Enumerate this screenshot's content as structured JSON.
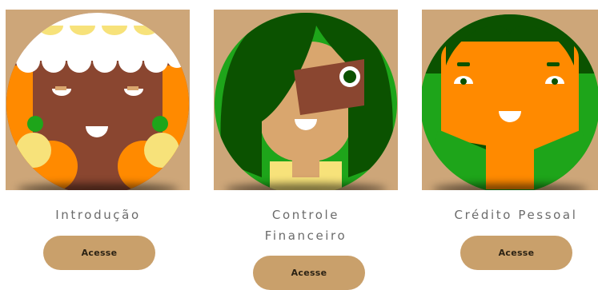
{
  "cards": [
    {
      "title": "Introdução",
      "button_label": "Acesse"
    },
    {
      "title": "Controle Financeiro",
      "button_label": "Acesse"
    },
    {
      "title": "Crédito Pessoal",
      "button_label": "Acesse"
    }
  ],
  "colors": {
    "card_background": "#cda679",
    "button": "#c9a06b",
    "title_text": "#6b6b6b",
    "dark_green": "#0b5200",
    "bright_green": "#1ea51a",
    "orange": "#ff8a00",
    "brown": "#8a4630",
    "tan": "#d9a66e",
    "yellow": "#f7e27a"
  }
}
